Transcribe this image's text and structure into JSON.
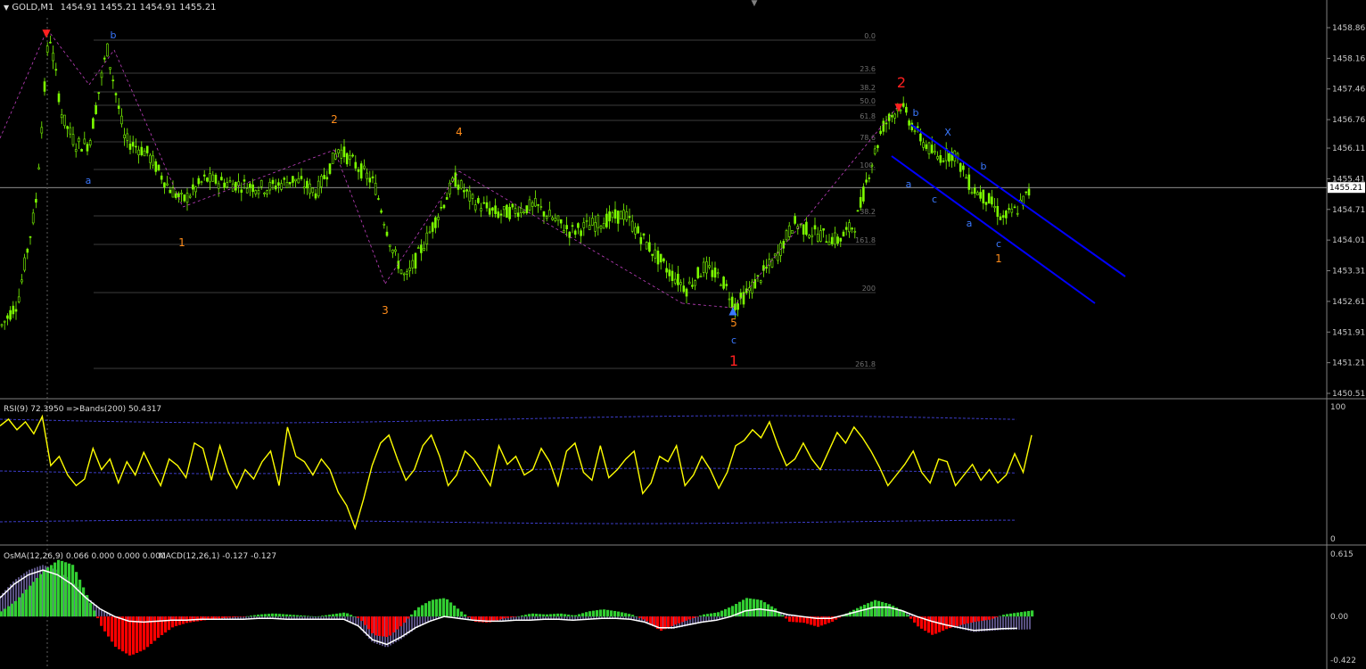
{
  "header": {
    "symbol": "GOLD,M1",
    "ohlc": "1454.91 1455.21 1454.91 1455.21",
    "menu_arrow": "triangle-down-icon"
  },
  "colors": {
    "background": "#000000",
    "bull_candle": "#7CFC00",
    "grid": "#505050",
    "price_line": "#c0c0c0",
    "rsi_line": "#ffff00",
    "rsi_bands": "#3c3cc8",
    "osma_pos_up": "#32cd32",
    "osma_neg": "#ff0000",
    "macd_hist": "#b0a0ff",
    "macd_signal": "#ffffff",
    "channel": "#0000ff",
    "wave_major": "#ff2020",
    "wave_minor": "#ff8c1a",
    "wave_sub": "#3a78ff"
  },
  "price_axis": {
    "ticks": [
      "1458.86",
      "1458.16",
      "1457.46",
      "1456.76",
      "1456.11",
      "1455.41",
      "1454.71",
      "1454.01",
      "1453.31",
      "1452.61",
      "1451.91",
      "1451.21",
      "1450.51"
    ],
    "current": "1455.21"
  },
  "fib_levels": [
    "0.0",
    "23.6",
    "38.2",
    "50.0",
    "61.8",
    "78.6",
    "100.",
    "38.2",
    "161.8",
    "200",
    "261.8"
  ],
  "wave_labels": {
    "major": [
      "1",
      "2"
    ],
    "minor": [
      "1",
      "2",
      "3",
      "4",
      "5",
      "1"
    ],
    "sub": [
      "a",
      "b",
      "c",
      "a",
      "b",
      "c",
      "X",
      "a",
      "b",
      "c"
    ]
  },
  "rsi": {
    "label": "RSI(9) 72.3950",
    "bands_label": "=>Bands(200) 50.4317",
    "axis_top": "100",
    "axis_bottom": "0"
  },
  "osma": {
    "label": "OsMA(12,26,9) 0.066 0.000 0.000 0.000",
    "macd_label": "MACD(12,26,1) -0.127 -0.127",
    "axis_top": "0.615",
    "axis_mid": "0.00",
    "axis_bottom": "-0.422"
  },
  "chart_data": [
    {
      "type": "candlestick",
      "title": "GOLD,M1",
      "ylim": [
        1450.51,
        1458.86
      ],
      "current_price": 1455.21,
      "path_points": [
        [
          0,
          1452.0
        ],
        [
          0.02,
          1452.6
        ],
        [
          0.04,
          1454.8
        ],
        [
          0.055,
          1458.8
        ],
        [
          0.07,
          1456.8
        ],
        [
          0.085,
          1456.2
        ],
        [
          0.1,
          1456.2
        ],
        [
          0.12,
          1458.4
        ],
        [
          0.14,
          1456.3
        ],
        [
          0.165,
          1456.0
        ],
        [
          0.19,
          1455.2
        ],
        [
          0.205,
          1454.9
        ],
        [
          0.23,
          1455.4
        ],
        [
          0.26,
          1455.3
        ],
        [
          0.3,
          1455.2
        ],
        [
          0.33,
          1455.4
        ],
        [
          0.355,
          1455.1
        ],
        [
          0.38,
          1456.1
        ],
        [
          0.42,
          1455.3
        ],
        [
          0.44,
          1453.8
        ],
        [
          0.455,
          1453.1
        ],
        [
          0.48,
          1454.1
        ],
        [
          0.51,
          1455.4
        ],
        [
          0.53,
          1454.9
        ],
        [
          0.56,
          1454.6
        ],
        [
          0.6,
          1454.8
        ],
        [
          0.64,
          1454.2
        ],
        [
          0.67,
          1454.4
        ],
        [
          0.7,
          1454.6
        ],
        [
          0.73,
          1453.8
        ],
        [
          0.75,
          1453.3
        ],
        [
          0.77,
          1452.9
        ],
        [
          0.79,
          1453.4
        ],
        [
          0.81,
          1453.1
        ],
        [
          0.825,
          1452.5
        ],
        [
          0.85,
          1453.1
        ],
        [
          0.87,
          1453.6
        ],
        [
          0.89,
          1454.4
        ],
        [
          0.91,
          1454.2
        ],
        [
          0.94,
          1454.0
        ],
        [
          0.96,
          1454.4
        ],
        [
          0.975,
          1455.6
        ],
        [
          0.99,
          1456.6
        ],
        [
          1.01,
          1457.1
        ],
        [
          1.03,
          1456.4
        ],
        [
          1.05,
          1455.9
        ],
        [
          1.07,
          1456.0
        ],
        [
          1.09,
          1455.2
        ],
        [
          1.11,
          1454.9
        ],
        [
          1.125,
          1454.5
        ],
        [
          1.14,
          1454.7
        ],
        [
          1.158,
          1455.2
        ]
      ]
    },
    {
      "type": "line",
      "title": "RSI(9)",
      "ylim": [
        0,
        100
      ],
      "values": [
        85,
        90,
        82,
        88,
        79,
        92,
        55,
        62,
        48,
        40,
        45,
        68,
        52,
        60,
        42,
        58,
        48,
        65,
        52,
        40,
        60,
        55,
        46,
        72,
        68,
        44,
        70,
        50,
        38,
        52,
        45,
        58,
        66,
        40,
        84,
        62,
        58,
        48,
        60,
        52,
        35,
        25,
        8,
        30,
        55,
        72,
        78,
        60,
        44,
        52,
        70,
        78,
        62,
        40,
        48,
        66,
        60,
        50,
        40,
        70,
        56,
        62,
        48,
        52,
        68,
        58,
        40,
        66,
        72,
        50,
        44,
        70,
        46,
        52,
        60,
        66,
        34,
        42,
        62,
        58,
        70,
        40,
        48,
        62,
        52,
        38,
        50,
        70,
        74,
        82,
        76,
        88,
        70,
        55,
        60,
        72,
        60,
        52,
        66,
        80,
        72,
        84,
        76,
        66,
        54,
        40,
        48,
        56,
        66,
        50,
        42,
        60,
        58,
        40,
        48,
        56,
        44,
        52,
        42,
        48,
        64,
        50,
        78
      ]
    },
    {
      "type": "bar",
      "title": "OsMA / MACD",
      "ylim": [
        -0.422,
        0.615
      ],
      "osma_values": [
        0.05,
        0.15,
        0.3,
        0.45,
        0.55,
        0.5,
        0.2,
        -0.1,
        -0.3,
        -0.38,
        -0.32,
        -0.2,
        -0.1,
        -0.06,
        -0.04,
        -0.02,
        -0.01,
        0.0,
        0.02,
        0.03,
        0.02,
        0.01,
        0.0,
        0.02,
        0.04,
        -0.02,
        -0.18,
        -0.2,
        -0.08,
        0.08,
        0.16,
        0.18,
        0.06,
        -0.05,
        -0.06,
        -0.02,
        0.0,
        0.03,
        0.02,
        0.03,
        0.01,
        0.05,
        0.07,
        0.05,
        0.02,
        -0.04,
        -0.14,
        -0.08,
        -0.03,
        0.02,
        0.04,
        0.1,
        0.18,
        0.16,
        0.08,
        -0.05,
        -0.06,
        -0.1,
        -0.05,
        0.03,
        0.1,
        0.16,
        0.12,
        0.05,
        -0.1,
        -0.18,
        -0.12,
        -0.08,
        -0.05,
        -0.03,
        0.02,
        0.04
      ],
      "macd_values": [
        0.2,
        0.35,
        0.45,
        0.5,
        0.45,
        0.35,
        0.2,
        0.08,
        0.0,
        -0.05,
        -0.06,
        -0.05,
        -0.04,
        -0.04,
        -0.03,
        -0.03,
        -0.03,
        -0.03,
        -0.02,
        -0.02,
        -0.03,
        -0.03,
        -0.03,
        -0.03,
        -0.03,
        -0.1,
        -0.25,
        -0.3,
        -0.22,
        -0.12,
        -0.05,
        0.0,
        -0.02,
        -0.04,
        -0.05,
        -0.05,
        -0.04,
        -0.04,
        -0.03,
        -0.03,
        -0.04,
        -0.03,
        -0.02,
        -0.02,
        -0.03,
        -0.06,
        -0.12,
        -0.12,
        -0.09,
        -0.06,
        -0.04,
        0.0,
        0.06,
        0.08,
        0.06,
        0.02,
        0.0,
        -0.02,
        -0.02,
        0.02,
        0.06,
        0.1,
        0.1,
        0.06,
        0.0,
        -0.05,
        -0.09,
        -0.12,
        -0.15,
        -0.14,
        -0.13,
        -0.127
      ]
    }
  ]
}
